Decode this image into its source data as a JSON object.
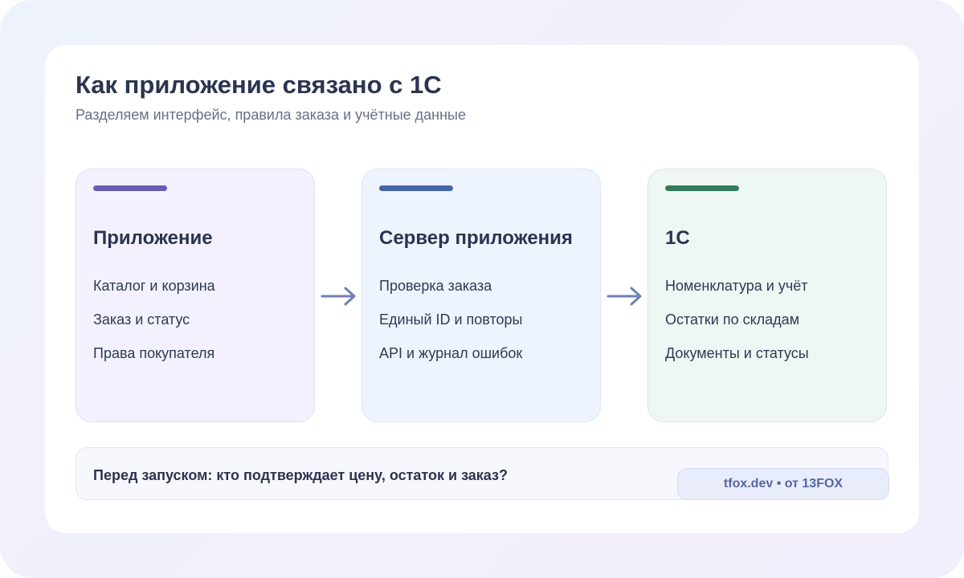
{
  "header": {
    "title": "Как приложение связано с 1С",
    "subtitle": "Разделяем интерфейс, правила заказа и учётные данные"
  },
  "blocks": [
    {
      "title": "Приложение",
      "accent": "#6b5cb4",
      "items": [
        "Каталог и корзина",
        "Заказ и статус",
        "Права покупателя"
      ]
    },
    {
      "title": "Сервер приложения",
      "accent": "#4466aa",
      "items": [
        "Проверка заказа",
        "Единый ID и повторы",
        "API и журнал ошибок"
      ]
    },
    {
      "title": "1С",
      "accent": "#2f7d5d",
      "items": [
        "Номенклатура и учёт",
        "Остатки по складам",
        "Документы и статусы"
      ]
    }
  ],
  "arrows": {
    "color": "#6d7fb4",
    "icon": "arrow-right-icon"
  },
  "footer": {
    "question": "Перед запуском: кто подтверждает цену, остаток и заказ?",
    "badge": "tfox.dev • от 13FOX"
  }
}
